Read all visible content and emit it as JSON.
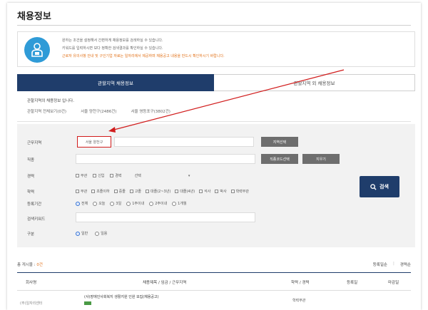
{
  "page": {
    "title": "채용정보"
  },
  "notice": {
    "lines": [
      {
        "text": "원하는 조건을 설정해서 간편하게 채용정보를 검색하실 수 있습니다.",
        "highlight": ""
      },
      {
        "text": "키워드를 입력하시면 보다 정확한 검색결과를 확인하실 수 있습니다.",
        "highlight": ""
      },
      {
        "text": "",
        "highlight": "근로자 유의사항 안내 및 구인기업 자료는 일자리에서 제공하며 채용공고 내용을 반드시 확인하시기 바랍니다."
      }
    ]
  },
  "tabs": [
    {
      "label": "관할지역 채용정보",
      "active": true
    },
    {
      "label": "관할지역 외 채용정보",
      "active": false
    }
  ],
  "region": {
    "title": "관할지역의 채용정보 입니다.",
    "links": [
      "관할지역 전체보기(0건)",
      "서울 양천구(2486건)",
      "서울 영등포구(3802건)"
    ]
  },
  "search": {
    "labels": {
      "location": "근무지역",
      "job": "직종",
      "career": "경력",
      "education": "학력",
      "period": "등록기간",
      "keyword": "검색키워드",
      "type": "구분"
    },
    "location_value": "서울 양천구",
    "buttons": {
      "region_select": "지역선택",
      "job_select": "직종코드선택",
      "reset": "지우기",
      "search": "검색"
    },
    "career_options": [
      "무관",
      "신입",
      "경력"
    ],
    "career_select": "선택",
    "education_options": [
      "무관",
      "초졸이하",
      "중졸",
      "고졸",
      "대졸(2~3년)",
      "대졸(4년)",
      "석사",
      "박사",
      "학력무관"
    ],
    "period_options": [
      "전체",
      "오늘",
      "3일",
      "1주이내",
      "2주이내",
      "1개월"
    ],
    "type_options": [
      "일반",
      "일용"
    ]
  },
  "list": {
    "total_label": "총 게시물 : ",
    "total_count": "0건",
    "sort": [
      "등록일순",
      "경력순"
    ],
    "columns": [
      "회사명",
      "채용제목 / 임금 / 근무지역",
      "학력 / 경력",
      "등록일",
      "마감일"
    ],
    "row": {
      "company": "(주)일자리센터",
      "title": "(사)장애인사회복지 생활지원 인원 모집(채용공고)",
      "education": "학력무관"
    }
  }
}
